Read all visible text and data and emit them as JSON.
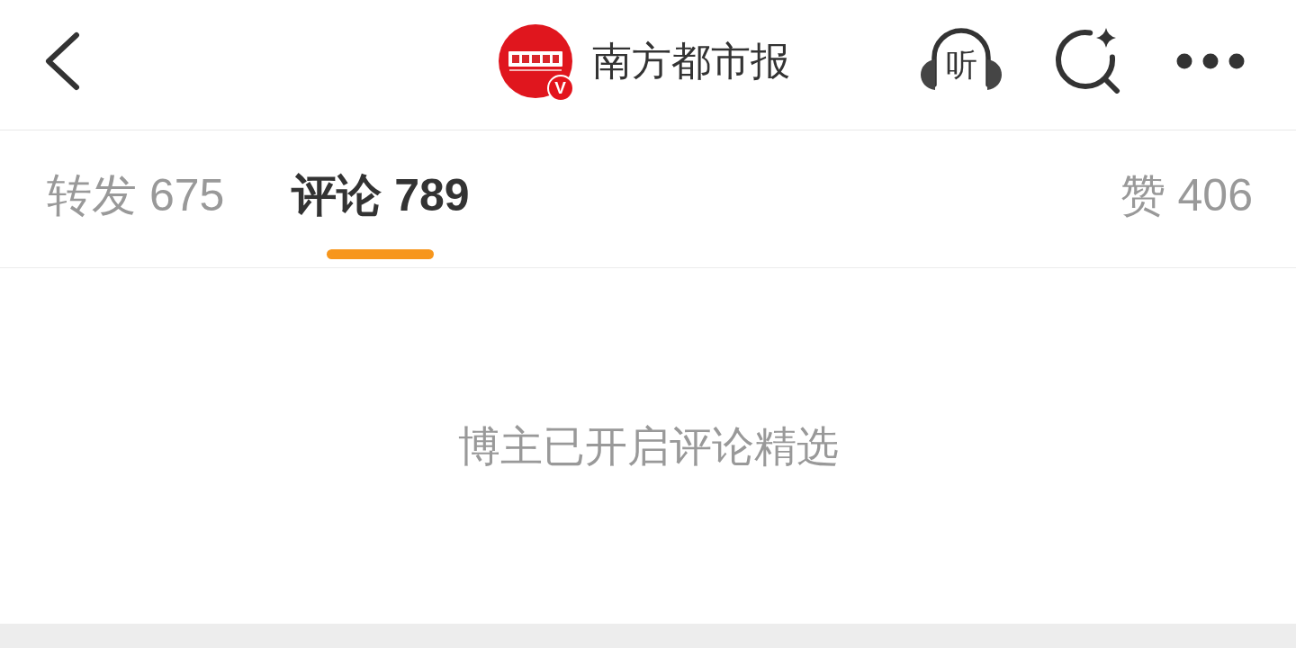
{
  "header": {
    "title": "南方都市报",
    "verified_badge": "V",
    "listen_label": "听"
  },
  "tabs": [
    {
      "label": "转发 675",
      "selected": false
    },
    {
      "label": "评论 789",
      "selected": true
    },
    {
      "label": "赞 406",
      "selected": false
    }
  ],
  "comments": {
    "empty_message": "博主已开启评论精选"
  }
}
